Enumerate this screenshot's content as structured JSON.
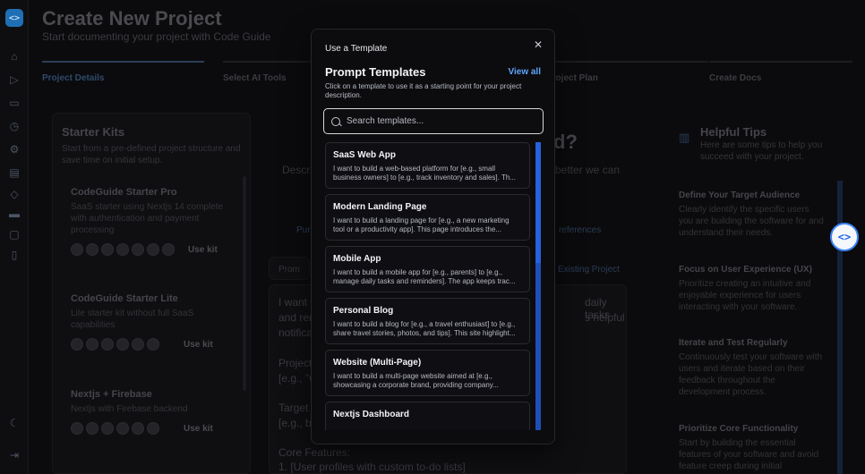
{
  "sidebar": {
    "logo": "<>",
    "icons": [
      "home-icon",
      "play-icon",
      "folder-icon",
      "clock-icon",
      "settings-icon",
      "book-icon",
      "cube-icon",
      "card-icon",
      "chat-icon",
      "document-icon",
      "moon-icon",
      "logout-icon"
    ]
  },
  "page": {
    "title": "Create New Project",
    "subtitle": "Start documenting your project with Code Guide",
    "steps": [
      "Project Details",
      "Select AI Tools",
      "Project Plan",
      "Create Docs"
    ]
  },
  "starter_kits": {
    "title": "Starter Kits",
    "description": "Start from a pre-defined project structure and save time on initial setup.",
    "use_kit_label": "Use kit",
    "kits": [
      {
        "name": "CodeGuide Starter Pro",
        "description": "SaaS starter using Nextjs 14 complete with authentication and payment processing"
      },
      {
        "name": "CodeGuide Starter Lite",
        "description": "Lite starter kit without full SaaS capabilities"
      },
      {
        "name": "Nextjs + Firebase",
        "description": "Nextjs with Firebase backend"
      }
    ]
  },
  "center": {
    "heading_fragment": "d?",
    "left_fragment": "Descri",
    "right_fragment": "better we can",
    "tab_left": "Pur",
    "tab_right": "references",
    "prompt_tab": "Prom",
    "existing_project": "Existing Project",
    "editor_lines": [
      "I want t",
      "and ren",
      "notifica",
      "Project",
      "[e.g., \"C",
      "Target A",
      "[e.g., b",
      "Core Features:",
      "1. [User profiles with custom to-do lists]"
    ],
    "editor_right_lines": [
      "daily tasks",
      "s helpful"
    ]
  },
  "tips": {
    "title": "Helpful Tips",
    "subtitle": "Here are some tips to help you succeed with your project.",
    "items": [
      {
        "title": "Define Your Target Audience",
        "text": "Clearly identify the specific users you are building the software for and understand their needs."
      },
      {
        "title": "Focus on User Experience (UX)",
        "text": "Prioritize creating an intuitive and enjoyable experience for users interacting with your software."
      },
      {
        "title": "Iterate and Test Regularly",
        "text": "Continuously test your software with users and iterate based on their feedback throughout the development process."
      },
      {
        "title": "Prioritize Core Functionality",
        "text": "Start by building the essential features of your software and avoid feature creep during initial"
      }
    ]
  },
  "modal": {
    "header": "Use a Template",
    "close_symbol": "✕",
    "section_title": "Prompt Templates",
    "view_all": "View all",
    "description": "Click on a template to use it as a starting point for your project description.",
    "search_placeholder": "Search templates...",
    "templates": [
      {
        "title": "SaaS Web App",
        "description": "I want to build a web-based platform for [e.g., small business owners] to [e.g., track inventory and sales]. Th..."
      },
      {
        "title": "Modern Landing Page",
        "description": "I want to build a landing page for [e.g., a new marketing tool or a productivity app]. This page introduces the..."
      },
      {
        "title": "Mobile App",
        "description": "I want to build a mobile app for [e.g., parents] to [e.g., manage daily tasks and reminders]. The app keeps trac..."
      },
      {
        "title": "Personal Blog",
        "description": "I want to build a blog for [e.g., a travel enthusiast] to [e.g., share travel stories, photos, and tips]. This site highlight..."
      },
      {
        "title": "Website (Multi-Page)",
        "description": "I want to build a multi-page website aimed at [e.g., showcasing a corporate brand, providing company..."
      },
      {
        "title": "Nextjs Dashboard",
        "description": ""
      }
    ]
  },
  "float_button": {
    "label": "<>"
  }
}
